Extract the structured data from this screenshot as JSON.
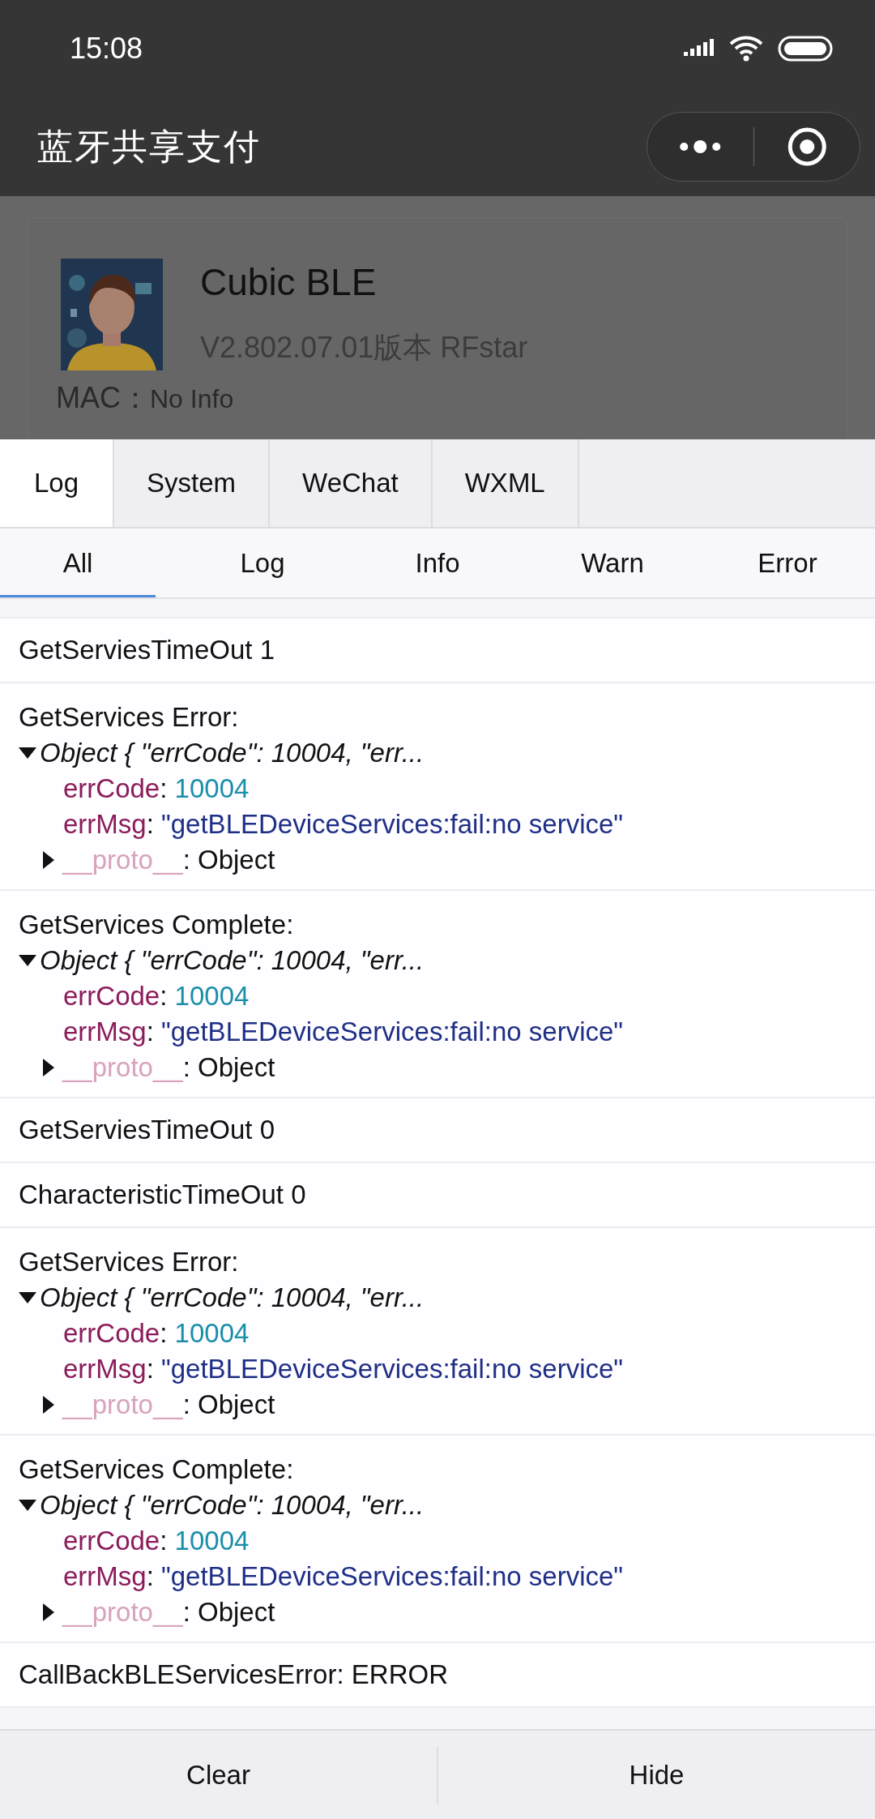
{
  "status_bar": {
    "time": "15:08"
  },
  "title_bar": {
    "title": "蓝牙共享支付"
  },
  "device": {
    "name": "Cubic BLE",
    "version": "V2.802.07.01版本 RFstar",
    "mac_label": "MAC：",
    "mac_value": "No Info"
  },
  "console": {
    "tabs": [
      {
        "label": "Log",
        "selected": true
      },
      {
        "label": "System",
        "selected": false
      },
      {
        "label": "WeChat",
        "selected": false
      },
      {
        "label": "WXML",
        "selected": false
      }
    ],
    "filters": [
      {
        "label": "All",
        "selected": true
      },
      {
        "label": "Log",
        "selected": false
      },
      {
        "label": "Info",
        "selected": false
      },
      {
        "label": "Warn",
        "selected": false
      },
      {
        "label": "Error",
        "selected": false
      }
    ],
    "entries": [
      {
        "kind": "text",
        "message": "GetServiesTimeOut 1"
      },
      {
        "kind": "object",
        "message": "GetServices Error:",
        "summary": "Object { \"errCode\": 10004, \"err...",
        "expanded": true,
        "props": [
          {
            "key": "errCode",
            "separator": ":",
            "value": "10004",
            "kind": "number"
          },
          {
            "key": "errMsg",
            "separator": ":",
            "value": "\"getBLEDeviceServices:fail:no service\"",
            "kind": "string"
          }
        ],
        "proto": {
          "key": "__proto__",
          "separator": ":",
          "value": "Object",
          "expanded": false
        }
      },
      {
        "kind": "object",
        "message": "GetServices Complete:",
        "summary": "Object { \"errCode\": 10004, \"err...",
        "expanded": true,
        "props": [
          {
            "key": "errCode",
            "separator": ":",
            "value": "10004",
            "kind": "number"
          },
          {
            "key": "errMsg",
            "separator": ":",
            "value": "\"getBLEDeviceServices:fail:no service\"",
            "kind": "string"
          }
        ],
        "proto": {
          "key": "__proto__",
          "separator": ":",
          "value": "Object",
          "expanded": false
        }
      },
      {
        "kind": "text",
        "message": "GetServiesTimeOut 0"
      },
      {
        "kind": "text",
        "message": "CharacteristicTimeOut 0"
      },
      {
        "kind": "object",
        "message": "GetServices Error:",
        "summary": "Object { \"errCode\": 10004, \"err...",
        "expanded": true,
        "props": [
          {
            "key": "errCode",
            "separator": ":",
            "value": "10004",
            "kind": "number"
          },
          {
            "key": "errMsg",
            "separator": ":",
            "value": "\"getBLEDeviceServices:fail:no service\"",
            "kind": "string"
          }
        ],
        "proto": {
          "key": "__proto__",
          "separator": ":",
          "value": "Object",
          "expanded": false
        }
      },
      {
        "kind": "object",
        "message": "GetServices Complete:",
        "summary": "Object { \"errCode\": 10004, \"err...",
        "expanded": true,
        "props": [
          {
            "key": "errCode",
            "separator": ":",
            "value": "10004",
            "kind": "number"
          },
          {
            "key": "errMsg",
            "separator": ":",
            "value": "\"getBLEDeviceServices:fail:no service\"",
            "kind": "string"
          }
        ],
        "proto": {
          "key": "__proto__",
          "separator": ":",
          "value": "Object",
          "expanded": false
        }
      },
      {
        "kind": "text",
        "message": "CallBackBLEServicesError: ERROR"
      }
    ],
    "buttons": [
      {
        "label": "Clear"
      },
      {
        "label": "Hide"
      }
    ]
  }
}
